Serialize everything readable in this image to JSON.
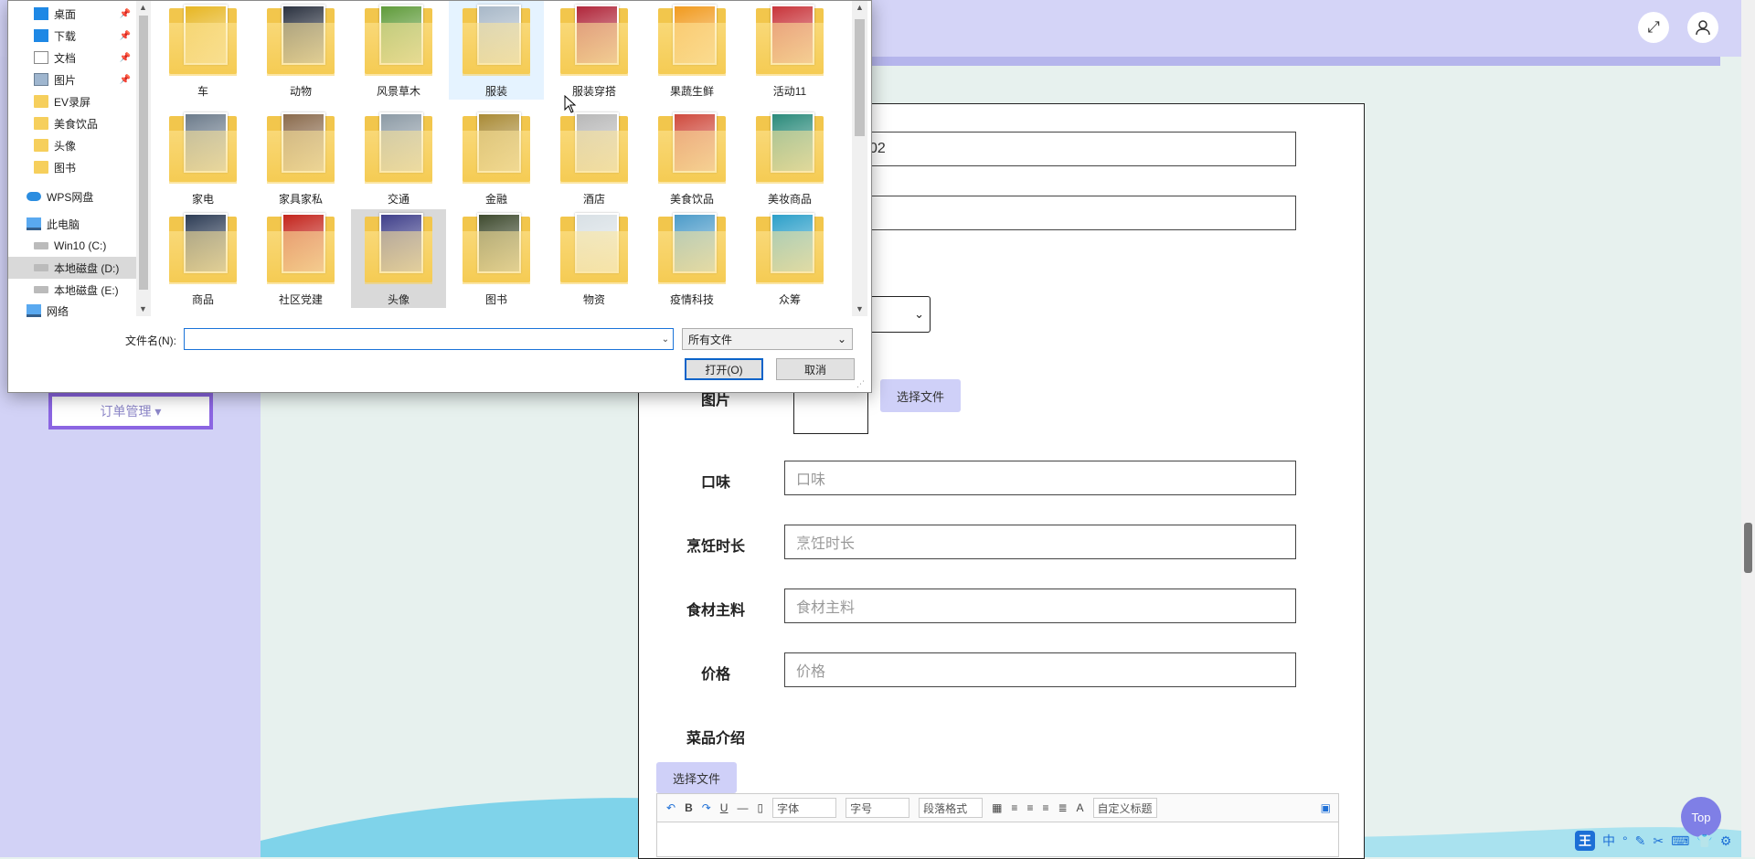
{
  "app": {
    "order_menu_label": "订单管理 ▾",
    "expand_icon": "⤢",
    "user_icon": "user-icon",
    "top_button_label": "Top"
  },
  "form": {
    "row1_value": "02",
    "image_label": "图片",
    "select_file_label": "选择文件",
    "taste": {
      "label": "口味",
      "placeholder": "口味"
    },
    "cook_time": {
      "label": "烹饪时长",
      "placeholder": "烹饪时长"
    },
    "ingredients": {
      "label": "食材主料",
      "placeholder": "食材主料"
    },
    "price": {
      "label": "价格",
      "placeholder": "价格"
    },
    "intro_label": "菜品介绍",
    "intro_select_file_label": "选择文件",
    "editor": {
      "font_label": "字体",
      "size_label": "字号",
      "paragraph_label": "段落格式",
      "custom_title_label": "自定义标题"
    }
  },
  "ime": {
    "items": [
      "王",
      "中",
      "°",
      "✎",
      "✂",
      "⌨",
      "👕",
      "⚙"
    ]
  },
  "dialog": {
    "nav": [
      {
        "label": "桌面",
        "icon": "desktop",
        "pinned": true
      },
      {
        "label": "下载",
        "icon": "download",
        "pinned": true
      },
      {
        "label": "文档",
        "icon": "doc",
        "pinned": true
      },
      {
        "label": "图片",
        "icon": "pic",
        "pinned": true
      },
      {
        "label": "EV录屏",
        "icon": "folder"
      },
      {
        "label": "美食饮品",
        "icon": "folder"
      },
      {
        "label": "头像",
        "icon": "folder"
      },
      {
        "label": "图书",
        "icon": "folder"
      },
      {
        "label": "WPS网盘",
        "icon": "cloud"
      },
      {
        "label": "此电脑",
        "icon": "pc"
      },
      {
        "label": "Win10 (C:)",
        "icon": "drive"
      },
      {
        "label": "本地磁盘 (D:)",
        "icon": "drive",
        "selected": true
      },
      {
        "label": "本地磁盘 (E:)",
        "icon": "drive"
      },
      {
        "label": "网络",
        "icon": "network"
      }
    ],
    "folders": [
      {
        "label": "车",
        "color": "#e7b622"
      },
      {
        "label": "动物",
        "color": "#2b3240"
      },
      {
        "label": "风景草木",
        "color": "#5f9b3a"
      },
      {
        "label": "服装",
        "color": "#a8b8c8",
        "state": "hover"
      },
      {
        "label": "服装穿搭",
        "color": "#b0263a"
      },
      {
        "label": "果蔬生鲜",
        "color": "#f19a1e"
      },
      {
        "label": "活动11",
        "color": "#c8343a"
      },
      {
        "label": "家电",
        "color": "#6c7b8b"
      },
      {
        "label": "家具家私",
        "color": "#8a6a4c"
      },
      {
        "label": "交通",
        "color": "#8c9aa5"
      },
      {
        "label": "金融",
        "color": "#a98a35"
      },
      {
        "label": "酒店",
        "color": "#b8b8b8"
      },
      {
        "label": "美食饮品",
        "color": "#cf4a3d"
      },
      {
        "label": "美妆商品",
        "color": "#2a8a7a"
      },
      {
        "label": "商品",
        "color": "#2d3c55"
      },
      {
        "label": "社区党建",
        "color": "#c3241c"
      },
      {
        "label": "头像",
        "color": "#3f3f8a",
        "state": "selected"
      },
      {
        "label": "图书",
        "color": "#3e4a2e"
      },
      {
        "label": "物资",
        "color": "#d8e0e5"
      },
      {
        "label": "疫情科技",
        "color": "#4c9bc9"
      },
      {
        "label": "众筹",
        "color": "#2c9fc9"
      }
    ],
    "filename_label": "文件名(N):",
    "filename_value": "",
    "filetype_value": "所有文件",
    "open_label": "打开(O)",
    "cancel_label": "取消"
  }
}
